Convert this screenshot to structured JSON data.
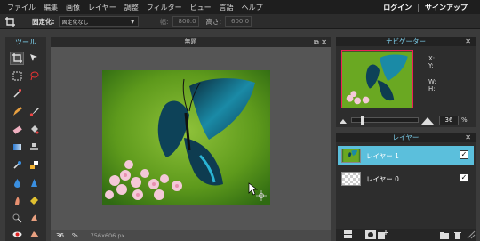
{
  "menu": [
    "ファイル",
    "編集",
    "画像",
    "レイヤー",
    "調整",
    "フィルター",
    "ビュー",
    "言語",
    "ヘルプ"
  ],
  "account": {
    "login": "ログイン",
    "separator": "|",
    "signup": "サインアップ"
  },
  "options": {
    "crop_label": "固定化:",
    "crop_mode": "固定化なし",
    "width_label": "幅:",
    "width_value": "800.0",
    "height_label": "高さ:",
    "height_value": "600.0"
  },
  "toolbox": {
    "title": "ツール"
  },
  "document": {
    "title": "無題",
    "zoom": "36",
    "zoom_unit": "%",
    "dimensions": "756x606 px"
  },
  "navigator": {
    "title": "ナビゲーター",
    "x_label": "X:",
    "y_label": "Y:",
    "w_label": "W:",
    "h_label": "H:",
    "zoom": "36",
    "zoom_unit": "%"
  },
  "layers": {
    "title": "レイヤー",
    "items": [
      {
        "name": "レイヤー 1",
        "selected": true,
        "visible": "✓"
      },
      {
        "name": "レイヤー 0",
        "selected": false,
        "visible": "✓"
      }
    ]
  },
  "colors": {
    "accent": "#7fd3f0",
    "selected_layer": "#5bbfdc",
    "active_red": "#e25"
  }
}
